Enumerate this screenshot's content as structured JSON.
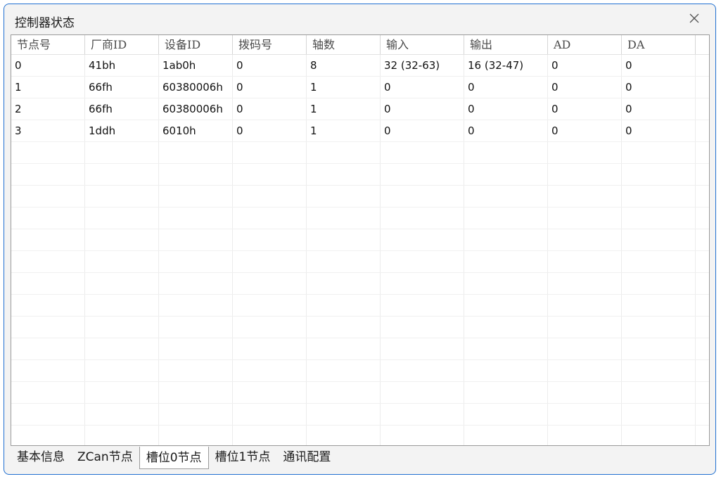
{
  "window": {
    "title": "控制器状态"
  },
  "table": {
    "columns": [
      "节点号",
      "厂商ID",
      "设备ID",
      "拨码号",
      "轴数",
      "输入",
      "输出",
      "AD",
      "DA"
    ],
    "rows": [
      [
        "0",
        "41bh",
        "1ab0h",
        "0",
        "8",
        "32 (32-63)",
        "16 (32-47)",
        "0",
        "0"
      ],
      [
        "1",
        "66fh",
        "60380006h",
        "0",
        "1",
        "0",
        "0",
        "0",
        "0"
      ],
      [
        "2",
        "66fh",
        "60380006h",
        "0",
        "1",
        "0",
        "0",
        "0",
        "0"
      ],
      [
        "3",
        "1ddh",
        "6010h",
        "0",
        "1",
        "0",
        "0",
        "0",
        "0"
      ]
    ]
  },
  "tabs": [
    {
      "label": "基本信息",
      "active": false
    },
    {
      "label": "ZCan节点",
      "active": false
    },
    {
      "label": "槽位0节点",
      "active": true
    },
    {
      "label": "槽位1节点",
      "active": false
    },
    {
      "label": "通讯配置",
      "active": false
    }
  ],
  "icons": {
    "close": "close-icon"
  },
  "colors": {
    "window_border": "#1f6fd1",
    "window_bg": "#f3f3f3",
    "grid_bg": "#ffffff"
  }
}
